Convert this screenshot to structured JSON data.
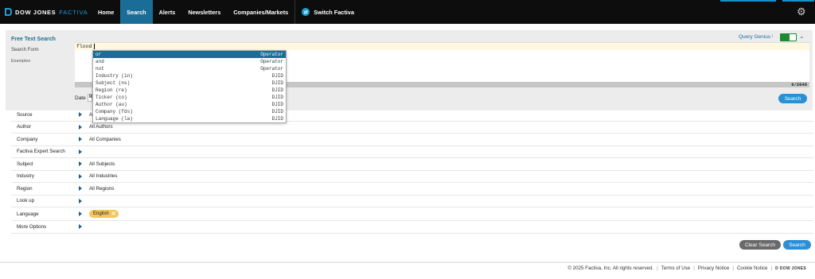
{
  "header": {
    "logo_brand": "DOW JONES",
    "logo_product": "FACTIVA",
    "nav": [
      {
        "label": "Home"
      },
      {
        "label": "Search"
      },
      {
        "label": "Alerts"
      },
      {
        "label": "Newsletters"
      },
      {
        "label": "Companies/Markets"
      }
    ],
    "switch_label": "Switch Factiva",
    "accent_color": "#1a6d96"
  },
  "search_panel": {
    "left_nav": {
      "free_text": "Free Text Search",
      "search_form": "Search Form",
      "examples": "Examples"
    },
    "query_text": "flood",
    "char_count": "6/2048",
    "query_genius": "Query Genius",
    "qg_separator": "i",
    "query_genius_on": true,
    "date_label": "Date",
    "date_value": "In",
    "search_button": "Search"
  },
  "autocomplete": [
    {
      "name": "or",
      "type": "Operator"
    },
    {
      "name": "and",
      "type": "Operator"
    },
    {
      "name": "not",
      "type": "Operator"
    },
    {
      "name": "Industry (in)",
      "type": "DJID"
    },
    {
      "name": "Subject (ns)",
      "type": "DJID"
    },
    {
      "name": "Region (re)",
      "type": "DJID"
    },
    {
      "name": "Ticker (co)",
      "type": "DJID"
    },
    {
      "name": "Author (au)",
      "type": "DJID"
    },
    {
      "name": "Company (fds)",
      "type": "DJID"
    },
    {
      "name": "Language (la)",
      "type": "DJID"
    }
  ],
  "filters": [
    {
      "label": "Source",
      "value": "A"
    },
    {
      "label": "Author",
      "value": "All Authors"
    },
    {
      "label": "Company",
      "value": "All Companies"
    },
    {
      "label": "Factiva Expert Search",
      "value": ""
    },
    {
      "label": "Subject",
      "value": "All Subjects"
    },
    {
      "label": "Industry",
      "value": "All Industries"
    },
    {
      "label": "Region",
      "value": "All Regions"
    },
    {
      "label": "Look up",
      "value": ""
    },
    {
      "label": "Language",
      "value": ""
    },
    {
      "label": "More Options",
      "value": ""
    }
  ],
  "language_chip": "English",
  "actions": {
    "clear": "Clear Search",
    "search": "Search"
  },
  "footer": {
    "copyright": "© 2025 Factiva, Inc. All rights reserved.",
    "terms": "Terms of Use",
    "privacy": "Privacy Notice",
    "cookie": "Cookie Notice",
    "mark_letter": "D",
    "mark_text": "DOW JONES"
  }
}
